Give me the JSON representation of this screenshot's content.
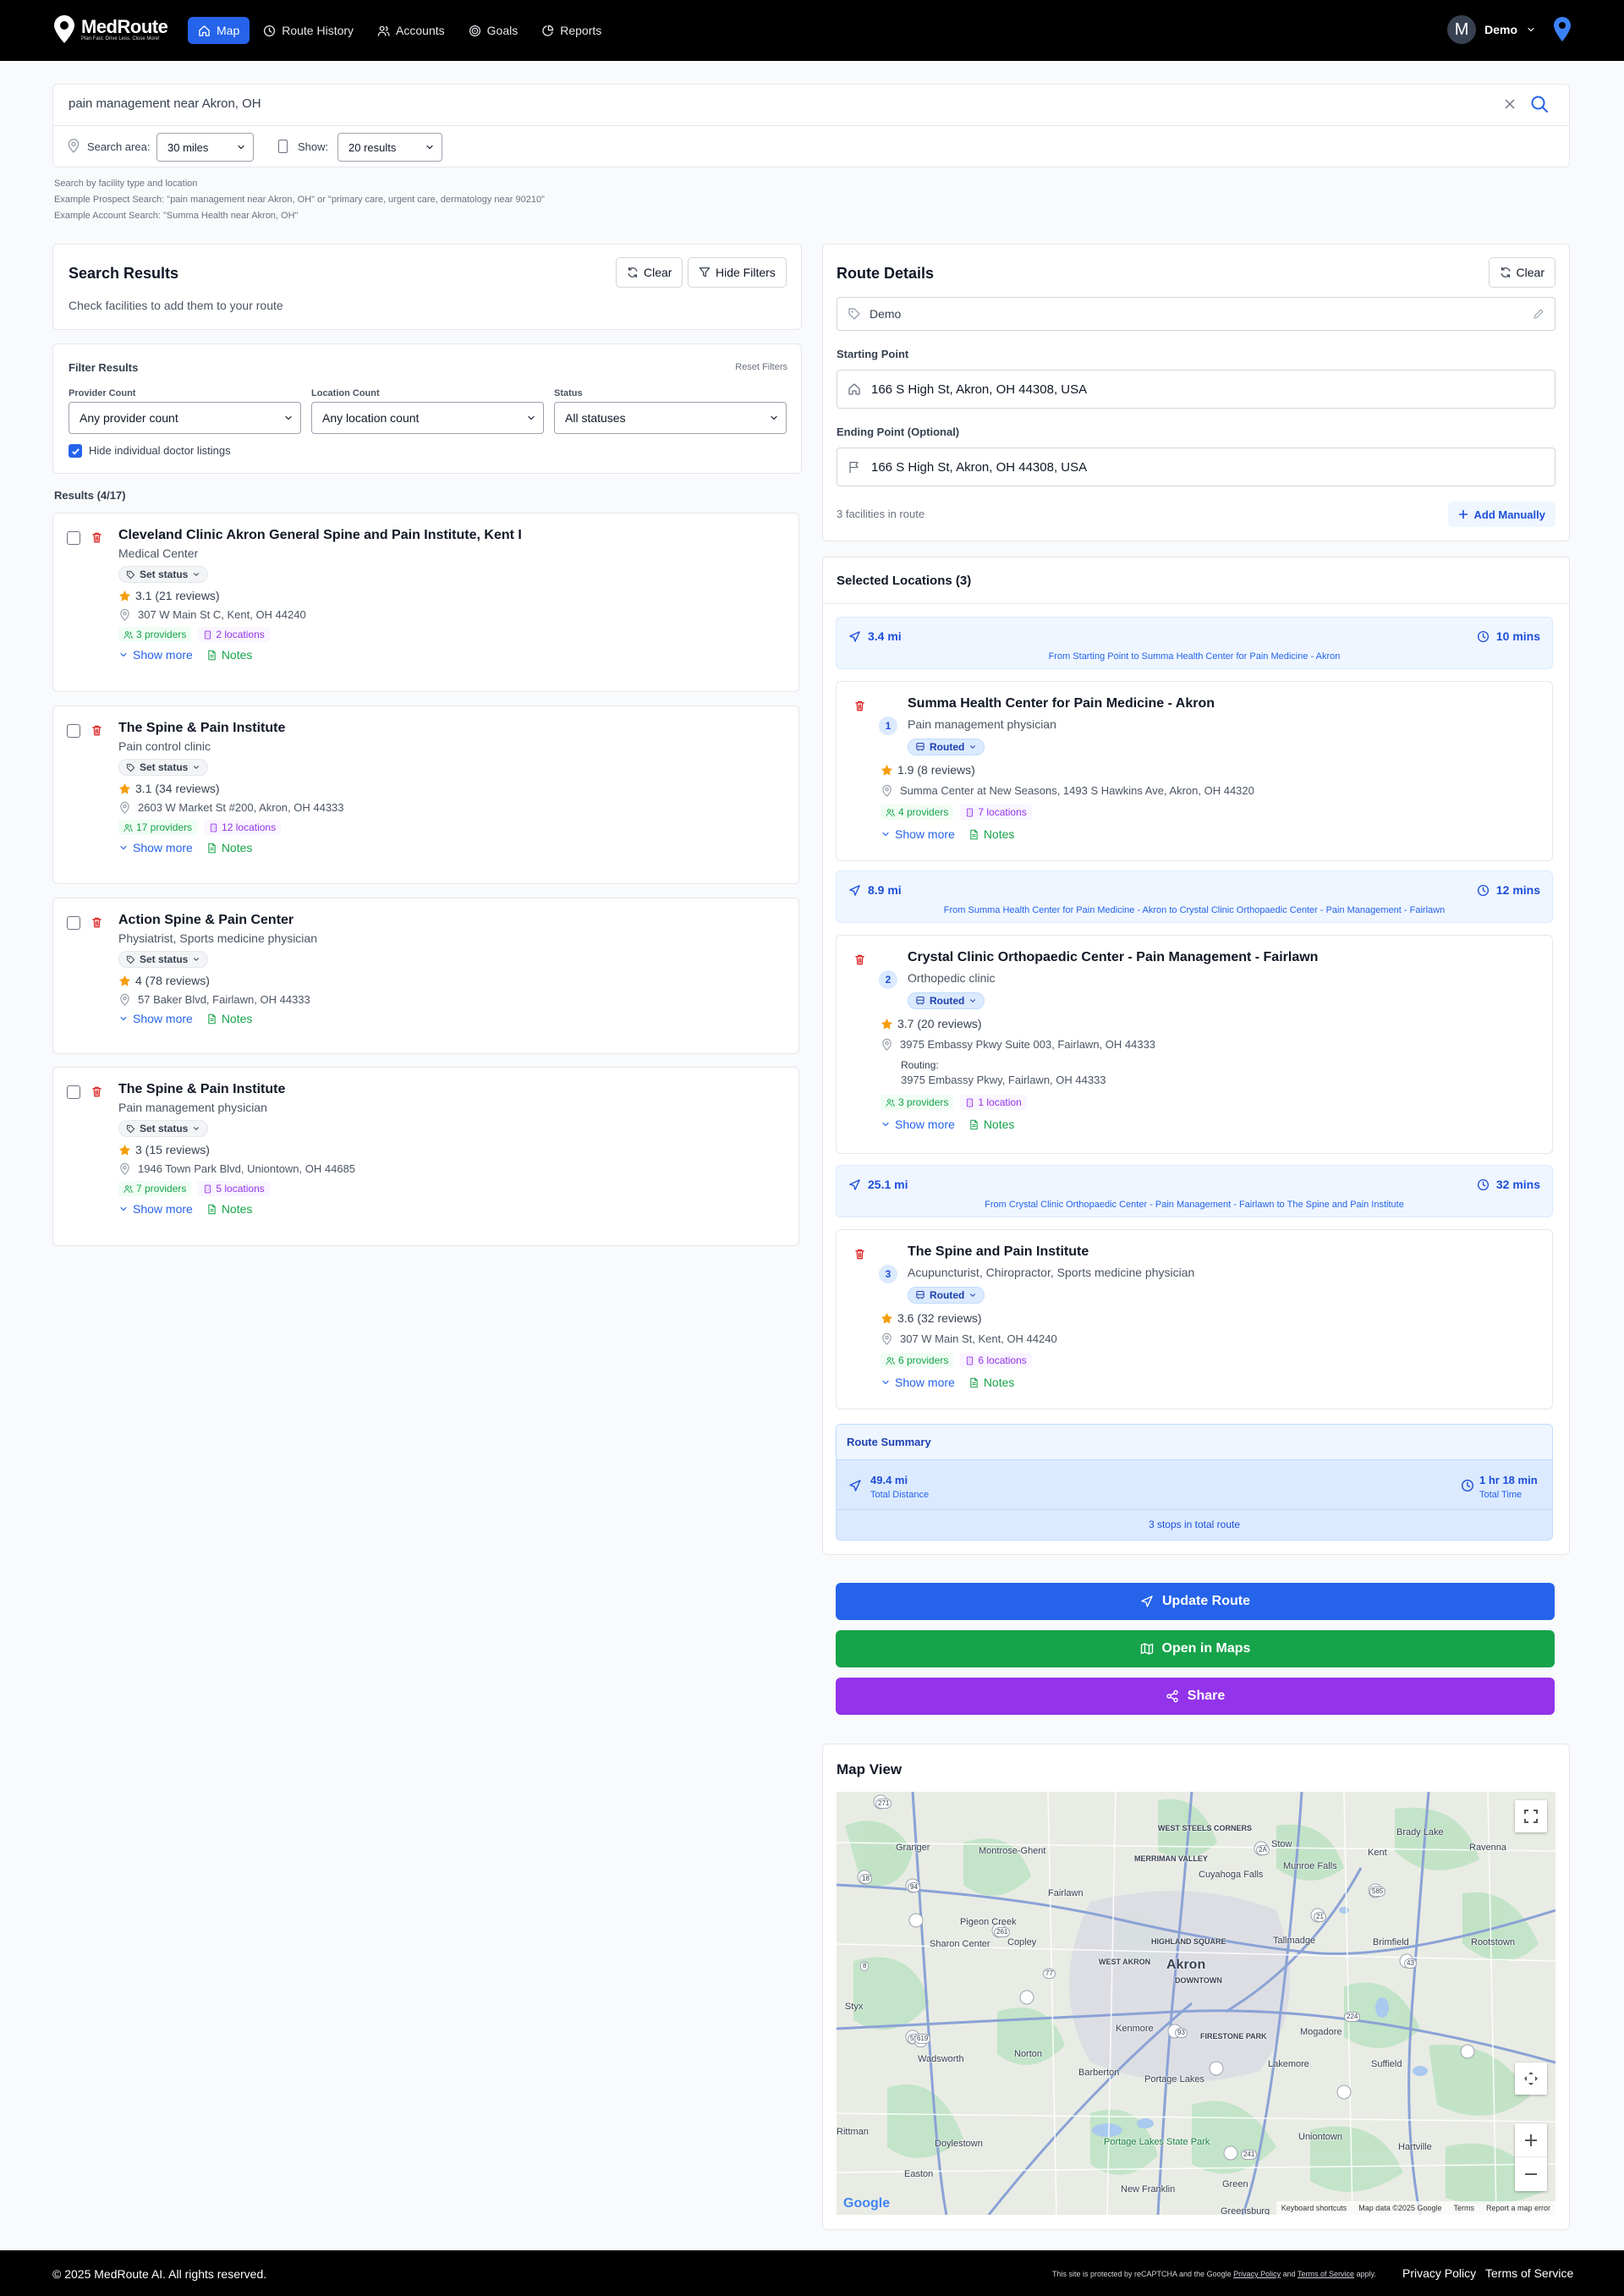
{
  "nav": {
    "brand": "MedRoute",
    "tagline": "Plan Fast. Drive Less. Close More!",
    "links": [
      {
        "label": "Map",
        "icon": "home-icon"
      },
      {
        "label": "Route History",
        "icon": "clock-icon"
      },
      {
        "label": "Accounts",
        "icon": "users-icon"
      },
      {
        "label": "Goals",
        "icon": "target-icon"
      },
      {
        "label": "Reports",
        "icon": "pie-chart-icon"
      }
    ],
    "user_initial": "M",
    "user_name": "Demo",
    "accent": "#2563eb"
  },
  "search": {
    "query": "pain management near Akron, OH",
    "area_label": "Search area:",
    "area_value": "30 miles",
    "show_label": "Show:",
    "show_value": "20 results",
    "hints": [
      "Search by facility type and location",
      "Example Prospect Search: \"pain management near Akron, OH\" or \"primary care, urgent care, dermatology near 90210\"",
      "Example Account Search: \"Summa Health near Akron, OH\""
    ]
  },
  "results_panel": {
    "title": "Search Results",
    "subtitle": "Check facilities to add them to your route",
    "clear_label": "Clear",
    "hide_filters_label": "Hide Filters"
  },
  "filters": {
    "title": "Filter Results",
    "reset_label": "Reset Filters",
    "provider_label": "Provider Count",
    "provider_value": "Any provider count",
    "location_label": "Location Count",
    "location_value": "Any location count",
    "status_label": "Status",
    "status_value": "All statuses",
    "hide_doctors_label": "Hide individual doctor listings",
    "hide_doctors_checked": true
  },
  "results_count": "Results (4/17)",
  "results": [
    {
      "name": "Cleveland Clinic Akron General Spine and Pain Institute, Kent I",
      "type": "Medical Center",
      "status": "Set status",
      "rating": "3.1 (21 reviews)",
      "address": "307 W Main St C, Kent, OH 44240",
      "providers": "3 providers",
      "locations": "2 locations",
      "show_more": "Show more",
      "notes": "Notes"
    },
    {
      "name": "The Spine & Pain Institute",
      "type": "Pain control clinic",
      "status": "Set status",
      "rating": "3.1 (34 reviews)",
      "address": "2603 W Market St #200, Akron, OH 44333",
      "providers": "17 providers",
      "locations": "12 locations",
      "show_more": "Show more",
      "notes": "Notes"
    },
    {
      "name": "Action Spine & Pain Center",
      "type": "Physiatrist, Sports medicine physician",
      "status": "Set status",
      "rating": "4 (78 reviews)",
      "address": "57 Baker Blvd, Fairlawn, OH 44333",
      "providers": "",
      "locations": "",
      "show_more": "Show more",
      "notes": "Notes"
    },
    {
      "name": "The Spine & Pain Institute",
      "type": "Pain management physician",
      "status": "Set status",
      "rating": "3 (15 reviews)",
      "address": "1946 Town Park Blvd, Uniontown, OH 44685",
      "providers": "7 providers",
      "locations": "5 locations",
      "show_more": "Show more",
      "notes": "Notes"
    }
  ],
  "route": {
    "title": "Route Details",
    "clear_label": "Clear",
    "name": "Demo",
    "start_label": "Starting Point",
    "start_value": "166 S High St, Akron, OH 44308, USA",
    "end_label": "Ending Point (Optional)",
    "end_value": "166 S High St, Akron, OH 44308, USA",
    "count_text": "3 facilities in route",
    "add_manually_label": "Add Manually"
  },
  "selected": {
    "title": "Selected Locations (3)",
    "legs": [
      {
        "distance": "3.4 mi",
        "time": "10 mins",
        "desc": "From Starting Point to Summa Health Center for Pain Medicine - Akron"
      },
      {
        "distance": "8.9 mi",
        "time": "12 mins",
        "desc": "From Summa Health Center for Pain Medicine - Akron to Crystal Clinic Orthopaedic Center - Pain Management - Fairlawn"
      },
      {
        "distance": "25.1 mi",
        "time": "32 mins",
        "desc": "From Crystal Clinic Orthopaedic Center - Pain Management - Fairlawn to The Spine and Pain Institute"
      }
    ],
    "stops": [
      {
        "num": "1",
        "name": "Summa Health Center for Pain Medicine - Akron",
        "type": "Pain management physician",
        "status": "Routed",
        "rating": "1.9 (8 reviews)",
        "address": "Summa Center at New Seasons, 1493 S Hawkins Ave, Akron, OH 44320",
        "routing_label": "",
        "routing_addr": "",
        "providers": "4 providers",
        "locations": "7 locations",
        "show_more": "Show more",
        "notes": "Notes"
      },
      {
        "num": "2",
        "name": "Crystal Clinic Orthopaedic Center - Pain Management - Fairlawn",
        "type": "Orthopedic clinic",
        "status": "Routed",
        "rating": "3.7 (20 reviews)",
        "address": "3975 Embassy Pkwy Suite 003, Fairlawn, OH 44333",
        "routing_label": "Routing:",
        "routing_addr": "3975 Embassy Pkwy, Fairlawn, OH 44333",
        "providers": "3 providers",
        "locations": "1 location",
        "show_more": "Show more",
        "notes": "Notes"
      },
      {
        "num": "3",
        "name": "The Spine and Pain Institute",
        "type": "Acupuncturist, Chiropractor, Sports medicine physician",
        "status": "Routed",
        "rating": "3.6 (32 reviews)",
        "address": "307 W Main St, Kent, OH 44240",
        "routing_label": "",
        "routing_addr": "",
        "providers": "6 providers",
        "locations": "6 locations",
        "show_more": "Show more",
        "notes": "Notes"
      }
    ],
    "summary": {
      "title": "Route Summary",
      "distance": "49.4 mi",
      "distance_label": "Total Distance",
      "time": "1 hr 18 min",
      "time_label": "Total Time",
      "stops": "3 stops in total route"
    }
  },
  "actions": {
    "update": "Update Route",
    "open": "Open in Maps",
    "share": "Share",
    "update_color": "#2563eb",
    "open_color": "#16a34a",
    "share_color": "#9333ea"
  },
  "map": {
    "title": "Map View",
    "places": [
      "Granger",
      "Montrose-Ghent",
      "West Steels Corners",
      "Merriman Valley",
      "Cuyahoga Falls",
      "Stow",
      "Munroe Falls",
      "Brady Lake",
      "Kent",
      "Ravenna",
      "Fairlawn",
      "Pigeon Creek",
      "Copley",
      "Highland Square",
      "Tallmadge",
      "Brimfield",
      "Rootstown",
      "Sharon Center",
      "West Akron",
      "Akron",
      "Downtown",
      "Styx",
      "Kenmore",
      "Firestone Park",
      "Mogadore",
      "Norton",
      "Wadsworth",
      "Barberton",
      "Portage Lakes",
      "Lakemore",
      "Suffield",
      "Rittman",
      "Doylestown",
      "Portage Lakes State Park",
      "Uniontown",
      "Hartville",
      "Easton",
      "New Franklin",
      "Green",
      "Greensburg"
    ],
    "road_labels": [
      "271",
      "18",
      "94",
      "8",
      "261",
      "59",
      "76",
      "77",
      "224",
      "43",
      "241",
      "619",
      "93",
      "21",
      "585",
      "2A"
    ],
    "attribution": [
      "Keyboard shortcuts",
      "Map data ©2025 Google",
      "Terms",
      "Report a map error"
    ],
    "google": "Google"
  },
  "footer": {
    "copyright": "© 2025 MedRoute AI. All rights reserved.",
    "recaptcha_prefix": "This site is protected by reCAPTCHA and the Google",
    "privacy_link": "Privacy Policy",
    "and": "and",
    "terms_link": "Terms of Service",
    "apply": "apply.",
    "privacy": "Privacy Policy",
    "terms": "Terms of Service"
  }
}
